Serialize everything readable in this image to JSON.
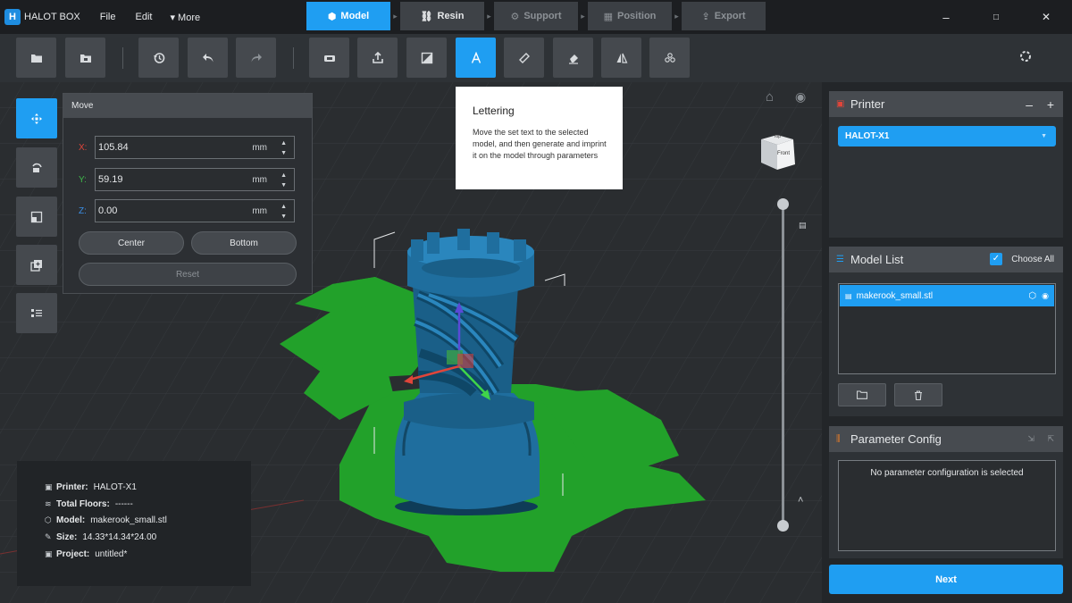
{
  "app": {
    "title": "HALOT BOX",
    "menu": [
      "File",
      "Edit",
      "▾ More"
    ]
  },
  "steps": [
    {
      "label": "Model",
      "icon": "cube-icon",
      "state": "active"
    },
    {
      "label": "Resin",
      "icon": "resin-icon",
      "state": "done"
    },
    {
      "label": "Support",
      "icon": "support-icon",
      "state": "disabled"
    },
    {
      "label": "Position",
      "icon": "grid-icon",
      "state": "disabled"
    },
    {
      "label": "Export",
      "icon": "export-icon",
      "state": "disabled"
    }
  ],
  "window_controls": [
    "–",
    "□",
    "✕"
  ],
  "toolbar": {
    "buttons": [
      "open-folder-icon",
      "import-icon",
      "history-icon",
      "undo-icon",
      "redo-icon",
      "print-icon",
      "export-model-icon",
      "cut-icon",
      "lettering-icon",
      "ruler-icon",
      "eraser-icon",
      "mirror-icon",
      "hollow-icon"
    ],
    "active": "lettering-icon",
    "settings_icon": "settings-icon"
  },
  "left_tools": {
    "items": [
      "move-icon",
      "rotate-icon",
      "scale-icon",
      "duplicate-icon",
      "list-icon"
    ],
    "active": "move-icon"
  },
  "move_panel": {
    "title": "Move",
    "x_label": "X:",
    "x_value": "105.84",
    "y_label": "Y:",
    "y_value": "59.19",
    "z_label": "Z:",
    "z_value": "0.00",
    "unit": "mm",
    "center_label": "Center",
    "bottom_label": "Bottom",
    "reset_label": "Reset",
    "colors": {
      "x": "#e0453a",
      "y": "#3fb84a",
      "z": "#3b8fe6"
    }
  },
  "tooltip": {
    "title": "Lettering",
    "body": "Move the set text to the selected model, and then generate and imprint it on the model through parameters"
  },
  "view_cube": {
    "top_label": "Top",
    "front_label": "Front"
  },
  "info": {
    "printer_label": "Printer:",
    "printer_value": "HALOT-X1",
    "floors_label": "Total Floors:",
    "floors_value": "------",
    "model_label": "Model:",
    "model_value": "makerook_small.stl",
    "size_label": "Size:",
    "size_value": "14.33*14.34*24.00",
    "project_label": "Project:",
    "project_value": "untitled*"
  },
  "printer_panel": {
    "title": "Printer",
    "selected": "HALOT-X1"
  },
  "model_list": {
    "title": "Model List",
    "choose_all_label": "Choose All",
    "choose_all_checked": true,
    "items": [
      "makerook_small.stl"
    ]
  },
  "parameter_config": {
    "title": "Parameter Config",
    "empty_message": "No parameter configuration is selected"
  },
  "next_label": "Next",
  "layer_slider": {
    "top_fraction": 1.0,
    "bottom_fraction": 0.0
  },
  "accent_color": "#1f9ef2",
  "model_color": "#1f6e9e",
  "plate_color": "#22a12a"
}
